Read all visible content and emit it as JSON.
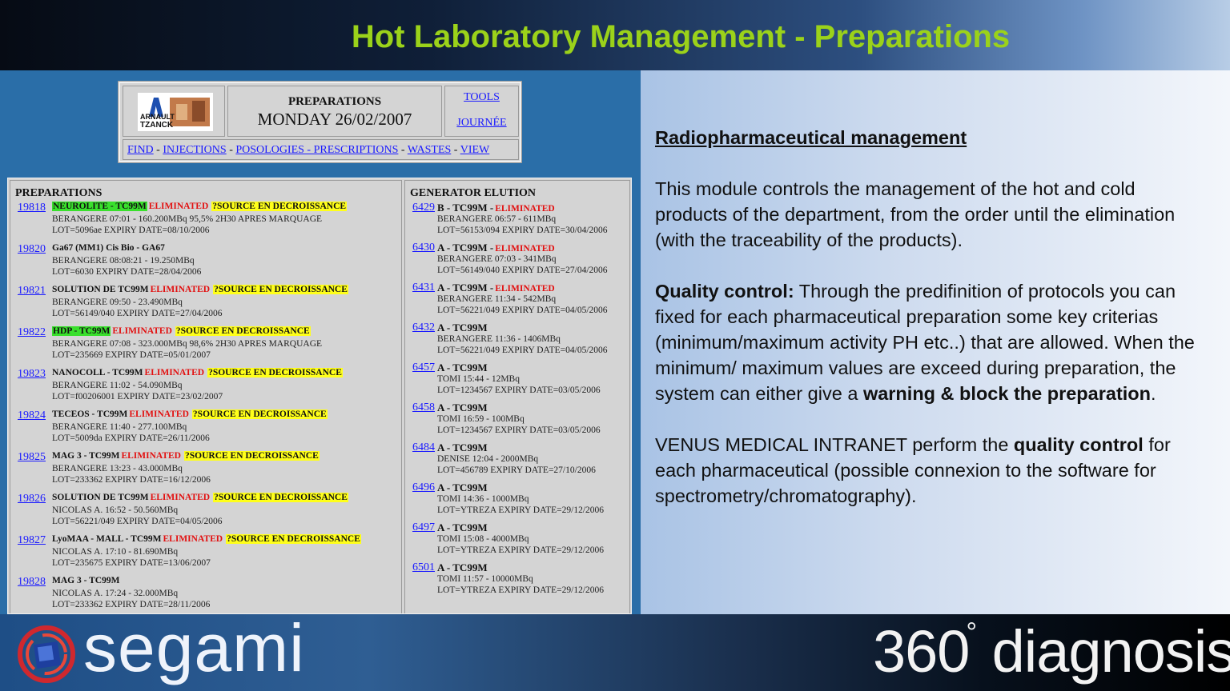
{
  "slide": {
    "title": "Hot Laboratory Management - Preparations"
  },
  "app": {
    "logo_text": "ARNAULT TZANCK",
    "heading": "PREPARATIONS",
    "date": "MONDAY 26/02/2007",
    "tools": "TOOLS",
    "journee": "JOURNÉE",
    "nav": [
      "FIND",
      "INJECTIONS",
      "POSOLOGIES - PRESCRIPTIONS",
      "WASTES",
      "VIEW"
    ],
    "nav_sep": " - "
  },
  "preparations": {
    "header": "PREPARATIONS",
    "entries": [
      {
        "id": "19818",
        "name": "NEUROLITE - TC99M",
        "green": true,
        "eliminated": "ELIMINATED",
        "source": "?SOURCE EN DECROISSANCE",
        "line1": "BERANGERE 07:01 - 160.200MBq 95,5% 2H30 APRES MARQUAGE",
        "line2": "LOT=5096ae EXPIRY DATE=08/10/2006"
      },
      {
        "id": "19820",
        "name": "Ga67 (MM1) Cis Bio - GA67",
        "green": false,
        "eliminated": "",
        "source": "",
        "line1": "BERANGERE 08:08:21 - 19.250MBq",
        "line2": "LOT=6030 EXPIRY DATE=28/04/2006"
      },
      {
        "id": "19821",
        "name": "SOLUTION DE TC99M",
        "green": false,
        "eliminated": "ELIMINATED",
        "source": "?SOURCE EN DECROISSANCE",
        "line1": "BERANGERE 09:50 - 23.490MBq",
        "line2": "LOT=56149/040 EXPIRY DATE=27/04/2006"
      },
      {
        "id": "19822",
        "name": "HDP - TC99M",
        "green": true,
        "eliminated": "ELIMINATED",
        "source": "?SOURCE EN DECROISSANCE",
        "line1": "BERANGERE 07:08 - 323.000MBq 98,6% 2H30 APRES MARQUAGE",
        "line2": "LOT=235669 EXPIRY DATE=05/01/2007"
      },
      {
        "id": "19823",
        "name": "NANOCOLL - TC99M",
        "green": false,
        "eliminated": "ELIMINATED",
        "source": "?SOURCE EN DECROISSANCE",
        "line1": "BERANGERE 11:02 - 54.090MBq",
        "line2": "LOT=f00206001 EXPIRY DATE=23/02/2007"
      },
      {
        "id": "19824",
        "name": "TECEOS - TC99M",
        "green": false,
        "eliminated": "ELIMINATED",
        "source": "?SOURCE EN DECROISSANCE",
        "line1": "BERANGERE 11:40 - 277.100MBq",
        "line2": "LOT=5009da EXPIRY DATE=26/11/2006"
      },
      {
        "id": "19825",
        "name": "MAG 3 - TC99M",
        "green": false,
        "eliminated": "ELIMINATED",
        "source": "?SOURCE EN DECROISSANCE",
        "line1": "BERANGERE 13:23 - 43.000MBq",
        "line2": "LOT=233362 EXPIRY DATE=16/12/2006"
      },
      {
        "id": "19826",
        "name": "SOLUTION DE TC99M",
        "green": false,
        "eliminated": "ELIMINATED",
        "source": "?SOURCE EN DECROISSANCE",
        "line1": "NICOLAS A. 16:52 - 50.560MBq",
        "line2": "LOT=56221/049 EXPIRY DATE=04/05/2006"
      },
      {
        "id": "19827",
        "name": "LyoMAA - MALL - TC99M",
        "green": false,
        "eliminated": "ELIMINATED",
        "source": "?SOURCE EN DECROISSANCE",
        "line1": "NICOLAS A. 17:10 - 81.690MBq",
        "line2": "LOT=235675 EXPIRY DATE=13/06/2007"
      },
      {
        "id": "19828",
        "name": "MAG 3 - TC99M",
        "green": false,
        "eliminated": "",
        "source": "",
        "line1": "NICOLAS A. 17:24 - 32.000MBq",
        "line2": "LOT=233362 EXPIRY DATE=28/11/2006"
      }
    ]
  },
  "generator": {
    "header": "GENERATOR ELUTION",
    "entries": [
      {
        "id": "6429",
        "name": "B - TC99M -",
        "eliminated": "ELIMINATED",
        "line1": "BERANGERE 06:57 - 611MBq",
        "line2": "LOT=56153/094 EXPIRY DATE=30/04/2006"
      },
      {
        "id": "6430",
        "name": "A - TC99M -",
        "eliminated": "ELIMINATED",
        "line1": "BERANGERE 07:03 - 341MBq",
        "line2": "LOT=56149/040 EXPIRY DATE=27/04/2006"
      },
      {
        "id": "6431",
        "name": "A - TC99M -",
        "eliminated": "ELIMINATED",
        "line1": "BERANGERE 11:34 - 542MBq",
        "line2": "LOT=56221/049 EXPIRY DATE=04/05/2006"
      },
      {
        "id": "6432",
        "name": "A - TC99M",
        "eliminated": "",
        "line1": "BERANGERE 11:36 - 1406MBq",
        "line2": "LOT=56221/049 EXPIRY DATE=04/05/2006"
      },
      {
        "id": "6457",
        "name": "A - TC99M",
        "eliminated": "",
        "line1": "TOMI 15:44 - 12MBq",
        "line2": "LOT=1234567 EXPIRY DATE=03/05/2006"
      },
      {
        "id": "6458",
        "name": "A - TC99M",
        "eliminated": "",
        "line1": "TOMI 16:59 - 100MBq",
        "line2": "LOT=1234567 EXPIRY DATE=03/05/2006"
      },
      {
        "id": "6484",
        "name": "A - TC99M",
        "eliminated": "",
        "line1": "DENISE 12:04 - 2000MBq",
        "line2": "LOT=456789 EXPIRY DATE=27/10/2006"
      },
      {
        "id": "6496",
        "name": "A - TC99M",
        "eliminated": "",
        "line1": "TOMI 14:36 - 1000MBq",
        "line2": "LOT=YTREZA EXPIRY DATE=29/12/2006"
      },
      {
        "id": "6497",
        "name": "A - TC99M",
        "eliminated": "",
        "line1": "TOMI 15:08 - 4000MBq",
        "line2": "LOT=YTREZA EXPIRY DATE=29/12/2006"
      },
      {
        "id": "6501",
        "name": "A - TC99M",
        "eliminated": "",
        "line1": "TOMI 11:57 - 10000MBq",
        "line2": "LOT=YTREZA EXPIRY DATE=29/12/2006"
      }
    ]
  },
  "description": {
    "heading": "Radiopharmaceutical management",
    "para1": "This module controls the management of the hot and cold products of the department, from the order until the elimination (with the traceability of the products).",
    "qc_label": "Quality control:",
    "qc_text": " Through the predifinition of protocols you can fixed for each pharmaceutical preparation some key criterias (minimum/maximum activity PH etc..) that are allowed. When the minimum/ maximum values are exceed during preparation, the system can either give a ",
    "qc_bold": "warning & block the preparation",
    "qc_end": ".",
    "venus_pre": "VENUS MEDICAL INTRANET perform the ",
    "venus_bold": "quality control",
    "venus_post": " for each pharmaceutical (possible connexion to the software for spectrometry/chromatography)."
  },
  "footer": {
    "segami": "segami",
    "diag_num": "360",
    "diag_deg": "°",
    "diag_word": " diagnosis",
    "diag_tm": "™"
  },
  "colors": {
    "title_green": "#9bd21a",
    "link_blue": "#1a1aff",
    "eliminated_red": "#e21010",
    "source_yellow": "#ffff1a",
    "name_green": "#39e02c"
  }
}
